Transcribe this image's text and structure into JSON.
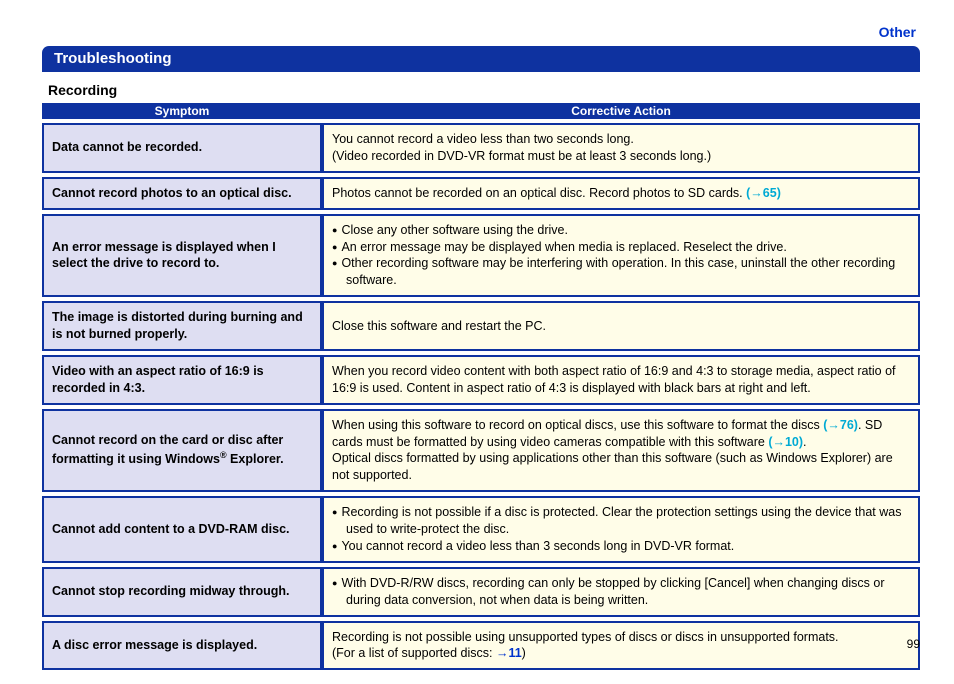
{
  "breadcrumb": "Other",
  "title": "Troubleshooting",
  "section": "Recording",
  "page_number": "99",
  "headers": {
    "symptom": "Symptom",
    "action": "Corrective Action"
  },
  "rows": [
    {
      "symptom": "Data cannot be recorded.",
      "action_lines": [
        "You cannot record a video less than two seconds long.",
        "(Video recorded in DVD-VR format must be at least 3 seconds long.)"
      ]
    },
    {
      "symptom": "Cannot record photos to an optical disc.",
      "action_text_pre": "Photos cannot be recorded on an optical disc. Record photos to SD cards. ",
      "action_link": "(→65)"
    },
    {
      "symptom": "An error message is displayed when I select the drive to record to.",
      "action_bullets": [
        "Close any other software using the drive.",
        "An error message may be displayed when media is replaced. Reselect the drive.",
        "Other recording software may be interfering with operation. In this case, uninstall the other recording software."
      ]
    },
    {
      "symptom": "The image is distorted during burning and is not burned properly.",
      "action_text": "Close this software and restart the PC."
    },
    {
      "symptom": "Video with an aspect ratio of 16:9 is recorded in 4:3.",
      "action_text": "When you record video content with both aspect ratio of 16:9 and 4:3 to storage media, aspect ratio of 16:9 is used. Content in aspect ratio of 4:3 is displayed with black bars at right and left."
    },
    {
      "symptom_html": "Cannot record on the card or disc after formatting it using Windows<sup>®</sup> Explorer.",
      "action_parts": {
        "p1": "When using this software to record on optical discs, use this software to format the discs ",
        "l1": "(→76)",
        "p2": ". SD cards must be formatted by using video cameras compatible with this software ",
        "l2": "(→10)",
        "p3": ".",
        "p4": "Optical discs formatted by using applications other than this software (such as Windows Explorer) are not supported."
      }
    },
    {
      "symptom": "Cannot add content to a DVD-RAM disc.",
      "action_bullets": [
        "Recording is not possible if a disc is protected. Clear the protection settings using the device that was used to write-protect the disc.",
        "You cannot record a video less than 3 seconds long in DVD-VR format."
      ]
    },
    {
      "symptom": "Cannot stop recording midway through.",
      "action_bullets": [
        "With DVD-R/RW discs, recording can only be stopped by clicking [Cancel] when changing discs or during data conversion, not when data is being written."
      ]
    },
    {
      "symptom": "A disc error message is displayed.",
      "action_parts2": {
        "p1": "Recording is not possible using unsupported types of discs or discs in unsupported formats.",
        "p2a": "(For a list of supported discs: ",
        "l": "→11",
        "p2b": ")"
      }
    }
  ]
}
